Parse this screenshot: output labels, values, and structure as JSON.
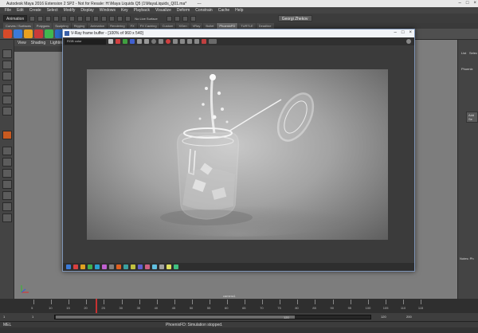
{
  "window": {
    "title": "Autodesk Maya 2016 Extension 2 SP2 - Not for Resale: H:\\Maya Liquids Q5 (1\\MayaLiquids_Q01.ma*",
    "title_extra": "---",
    "scene_node": "PhoenixFDSim1"
  },
  "menu": [
    "File",
    "Edit",
    "Create",
    "Select",
    "Modify",
    "Display",
    "Windows",
    "Key",
    "Playback",
    "Visualize",
    "Deform",
    "Constrain",
    "Cache",
    "Help"
  ],
  "status": {
    "mode": "Animation",
    "live_surface": "No Live Surface",
    "user": "Georgi Zhekov"
  },
  "shelf_tabs": [
    {
      "label": "Curves / Surfaces",
      "active": false
    },
    {
      "label": "Polygons",
      "active": false
    },
    {
      "label": "Sculpting",
      "active": false
    },
    {
      "label": "Rigging",
      "active": false
    },
    {
      "label": "Animation",
      "active": false
    },
    {
      "label": "Rendering",
      "active": false
    },
    {
      "label": "FX",
      "active": false
    },
    {
      "label": "FX Caching",
      "active": false
    },
    {
      "label": "Custom",
      "active": false
    },
    {
      "label": "XGen",
      "active": false
    },
    {
      "label": "VRay",
      "active": false
    },
    {
      "label": "Bullet",
      "active": false
    },
    {
      "label": "PhoenixFD",
      "active": true
    },
    {
      "label": "TURTLE",
      "active": false
    },
    {
      "label": "Deadline",
      "active": false
    }
  ],
  "shelf_icon_colors": [
    "#d84a2a",
    "#3a7ad8",
    "#e8a020",
    "#c83a3a",
    "#40b850",
    "#2a6ac8",
    "#e06a20",
    "#8a8a8a",
    "#2a9ae0"
  ],
  "viewport": {
    "menu": [
      "View",
      "Shading",
      "Lighting"
    ],
    "camera_label": "camera1"
  },
  "vfb": {
    "title": "V-Ray frame buffer - [100% of 960 x 540]",
    "channel": "RGB color",
    "bottom_icon_colors": [
      "#3a7ad8",
      "#d84040",
      "#e0a020",
      "#40b050",
      "#2aa0d0",
      "#c060d0",
      "#808080",
      "#e06020",
      "#3aa0a0",
      "#c0c040",
      "#6060d0",
      "#d06080",
      "#60c0e0",
      "#a0a0a0",
      "#e0e060",
      "#40c080"
    ]
  },
  "right_panel": {
    "tabs": [
      "List",
      "Selec"
    ],
    "node": "Phoenix",
    "add_button": "Add Se",
    "notes_label": "Notes: Ph"
  },
  "timeline": {
    "ticks": [
      "5",
      "10",
      "15",
      "20",
      "25",
      "30",
      "35",
      "40",
      "45",
      "50",
      "55",
      "60",
      "65",
      "70",
      "75",
      "80",
      "85",
      "90",
      "95",
      "100",
      "105",
      "110",
      "115"
    ],
    "range_start": "1",
    "range_start2": "1",
    "range_end_inner": "120",
    "range_end": "120",
    "range_end2": "200"
  },
  "command": {
    "language": "MEL",
    "result": "PhoenixFD: Simulation stopped."
  }
}
